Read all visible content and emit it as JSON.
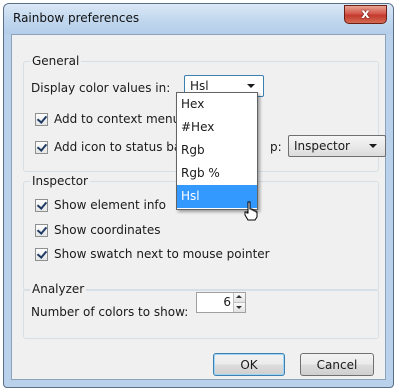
{
  "window": {
    "title": "Rainbow preferences",
    "close_glyph": "x"
  },
  "general": {
    "legend": "General",
    "display_label": "Display color values in:",
    "display_value": "Hsl",
    "context_menu_label": "Add to context menu",
    "status_bar_label": "Add icon to status bar",
    "status_bar_suffix": "p:",
    "status_bar_value": "Inspector"
  },
  "dropdown": {
    "options": [
      "Hex",
      "#Hex",
      "Rgb",
      "Rgb %",
      "Hsl"
    ],
    "selected": "Hsl"
  },
  "inspector": {
    "legend": "Inspector",
    "show_element_info": "Show element info",
    "show_coordinates": "Show coordinates",
    "show_swatch": "Show swatch next to mouse pointer"
  },
  "analyzer": {
    "legend": "Analyzer",
    "colors_label": "Number of colors to show:",
    "colors_value": "6"
  },
  "buttons": {
    "ok": "OK",
    "cancel": "Cancel"
  }
}
